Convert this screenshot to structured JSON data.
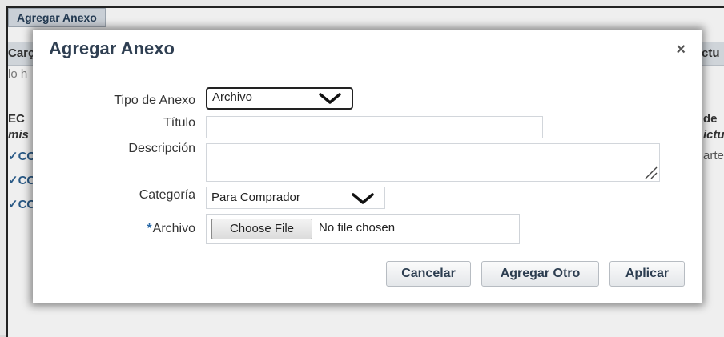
{
  "background": {
    "tab_title": "Agregar Anexo",
    "header_left_fragment": "Carç",
    "header_right_fragment": "ctu",
    "row_left_fragment": "lo h",
    "left_fragments": [
      "EC",
      "mis",
      "CC",
      "CC",
      "CC"
    ],
    "right_fragments": [
      "de",
      "ictu",
      "arte"
    ]
  },
  "dialog": {
    "title": "Agregar Anexo",
    "close_glyph": "×",
    "fields": {
      "tipo_label": "Tipo de Anexo",
      "tipo_value": "Archivo",
      "titulo_label": "Título",
      "titulo_value": "",
      "descripcion_label": "Descripción",
      "descripcion_value": "",
      "categoria_label": "Categoría",
      "categoria_value": "Para Comprador",
      "archivo_required_mark": "*",
      "archivo_label": "Archivo",
      "choose_file_label": "Choose File",
      "file_status": "No file chosen"
    },
    "buttons": {
      "cancel": "Cancelar",
      "add_another": "Agregar Otro",
      "apply": "Aplicar"
    }
  },
  "icons": {
    "close": "close-icon",
    "chevron": "chevron-down-icon",
    "resize": "resize-grip-icon",
    "link": "checkmark-icon"
  },
  "colors": {
    "title_text": "#2f3f52",
    "required_mark": "#2a6aa8"
  }
}
